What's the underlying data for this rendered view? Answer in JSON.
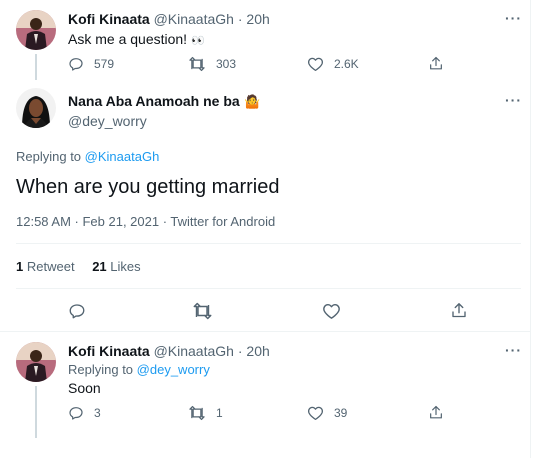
{
  "tweet1": {
    "name": "Kofi Kinaata",
    "handle": "@KinaataGh",
    "separator": "·",
    "time": "20h",
    "text": "Ask me a question!",
    "emoji": "👀",
    "replies": "579",
    "retweets": "303",
    "likes": "2.6K"
  },
  "main": {
    "name": "Nana Aba Anamoah ne ba",
    "emoji": "🤷",
    "handle": "@dey_worry",
    "replying_prefix": "Replying to",
    "replying_to": "@KinaataGh",
    "text": "When are you getting married",
    "timestamp": "12:58 AM · Feb 21, 2021 · Twitter for Android",
    "retweet_count": "1",
    "retweet_label": "Retweet",
    "like_count": "21",
    "like_label": "Likes"
  },
  "reply": {
    "name": "Kofi Kinaata",
    "handle": "@KinaataGh",
    "separator": "·",
    "time": "20h",
    "replying_prefix": "Replying to",
    "replying_to": "@dey_worry",
    "text": "Soon",
    "replies": "3",
    "retweets": "1",
    "likes": "39"
  },
  "more_label": "···",
  "colors": {
    "text": "#0f1419",
    "muted": "#536471",
    "link": "#1d9bf0",
    "border": "#eff3f4"
  },
  "icons": [
    "reply-icon",
    "retweet-icon",
    "like-icon",
    "share-icon",
    "more-icon"
  ]
}
